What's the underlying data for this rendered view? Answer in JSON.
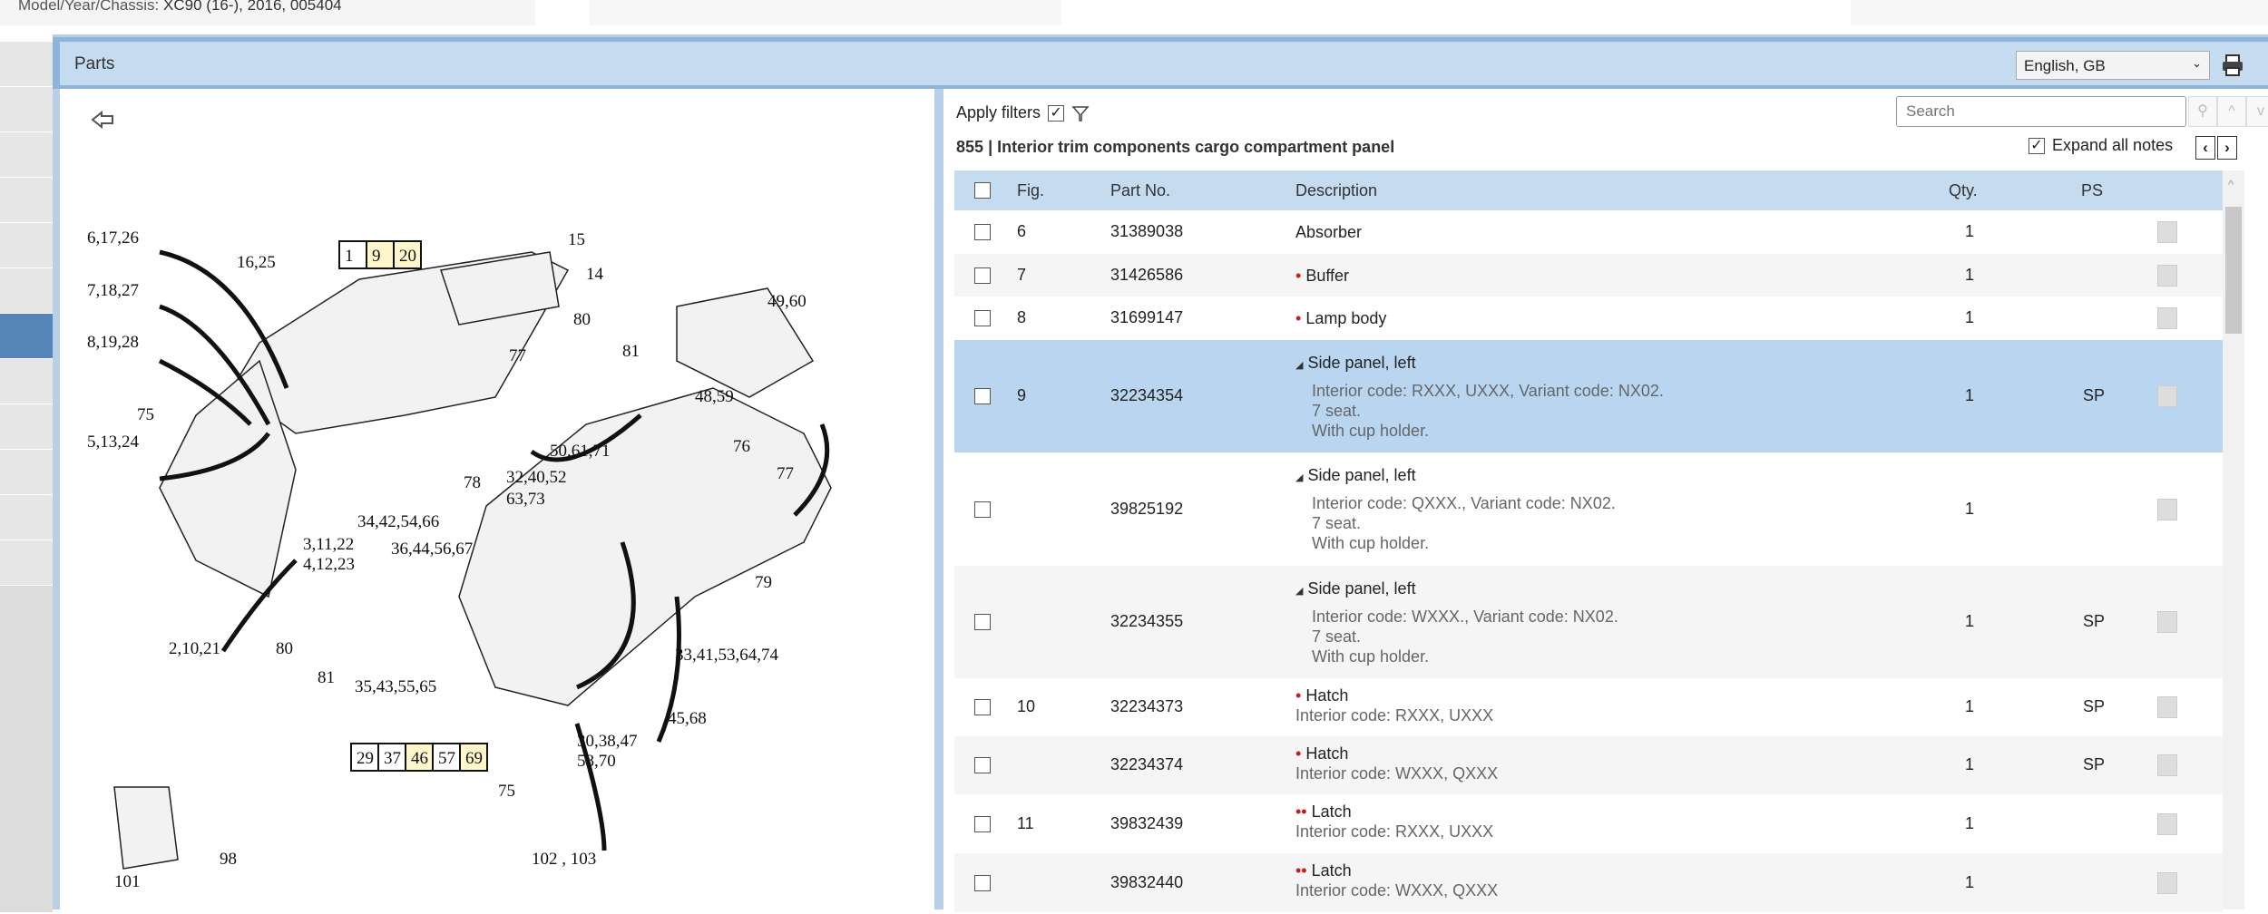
{
  "header": {
    "model_label": "Model/Year/Chassis:",
    "model_value": "XC90 (16-), 2016, 005404"
  },
  "panel": {
    "title": "Parts",
    "language": "English, GB"
  },
  "diagram": {
    "labels": [
      "6,17,26",
      "16,25",
      "15",
      "14",
      "7,18,27",
      "8,19,28",
      "75",
      "5,13,24",
      "77",
      "80",
      "81",
      "49,60",
      "48,59",
      "50,61,71",
      "76",
      "77",
      "32,40,52",
      "63,73",
      "78",
      "34,42,54,66",
      "36,44,56,67",
      "3,11,22",
      "4,12,23",
      "2,10,21",
      "35,43,55,65",
      "80",
      "81",
      "79",
      "33,41,53,64,74",
      "45,68",
      "30,38,47",
      "58,70",
      "75",
      "101",
      "98",
      "102 , 103"
    ],
    "boxes_top": [
      "1",
      "9",
      "20"
    ],
    "boxes_bottom": [
      "29",
      "37",
      "46",
      "57",
      "69"
    ]
  },
  "filters": {
    "apply_label": "Apply filters",
    "apply_checked": true,
    "search_placeholder": "Search",
    "expand_label": "Expand all notes",
    "expand_checked": true
  },
  "group": {
    "number": "855",
    "separator": "|",
    "title": "Interior trim components cargo compartment panel"
  },
  "columns": {
    "fig": "Fig.",
    "part": "Part No.",
    "desc": "Description",
    "qty": "Qty.",
    "ps": "PS"
  },
  "rows": [
    {
      "fig": "6",
      "part": "31389038",
      "bullet": "",
      "desc": "Absorber",
      "notes": [],
      "qty": "1",
      "ps": ""
    },
    {
      "fig": "7",
      "part": "31426586",
      "bullet": "•",
      "desc": "Buffer",
      "notes": [],
      "qty": "1",
      "ps": ""
    },
    {
      "fig": "8",
      "part": "31699147",
      "bullet": "•",
      "desc": "Lamp body",
      "notes": [],
      "qty": "1",
      "ps": ""
    },
    {
      "fig": "9",
      "part": "32234354",
      "bullet": "◢",
      "desc": "Side panel, left",
      "notes": [
        "Interior code: RXXX, UXXX, Variant code: NX02.",
        "7 seat.",
        "With cup holder."
      ],
      "qty": "1",
      "ps": "SP",
      "selected": true
    },
    {
      "fig": "",
      "part": "39825192",
      "bullet": "◢",
      "desc": "Side panel, left",
      "notes": [
        "Interior code: QXXX., Variant code: NX02.",
        "7 seat.",
        "With cup holder."
      ],
      "qty": "1",
      "ps": ""
    },
    {
      "fig": "",
      "part": "32234355",
      "bullet": "◢",
      "desc": "Side panel, left",
      "notes": [
        "Interior code: WXXX., Variant code: NX02.",
        "7 seat.",
        "With cup holder."
      ],
      "qty": "1",
      "ps": "SP"
    },
    {
      "fig": "10",
      "part": "32234373",
      "bullet": "•",
      "desc": "Hatch",
      "notes": [
        "Interior code: RXXX, UXXX"
      ],
      "qty": "1",
      "ps": "SP"
    },
    {
      "fig": "",
      "part": "32234374",
      "bullet": "•",
      "desc": "Hatch",
      "notes": [
        "Interior code: WXXX, QXXX"
      ],
      "qty": "1",
      "ps": "SP"
    },
    {
      "fig": "11",
      "part": "39832439",
      "bullet": "••",
      "desc": "Latch",
      "notes": [
        "Interior code: RXXX, UXXX"
      ],
      "qty": "1",
      "ps": ""
    },
    {
      "fig": "",
      "part": "39832440",
      "bullet": "••",
      "desc": "Latch",
      "notes": [
        "Interior code: WXXX, QXXX"
      ],
      "qty": "1",
      "ps": ""
    }
  ]
}
